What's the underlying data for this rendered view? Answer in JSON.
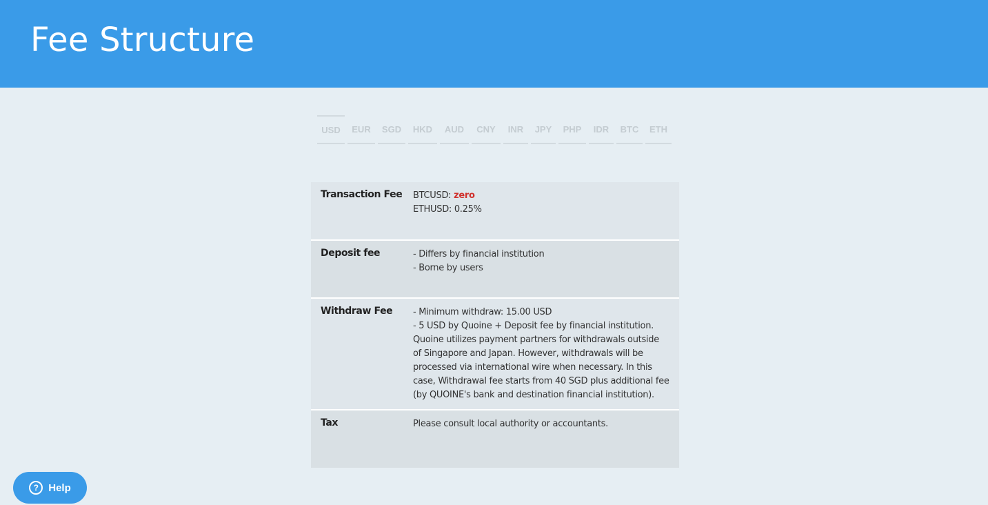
{
  "header": {
    "title": "Fee Structure"
  },
  "currency_tabs": {
    "active": "USD",
    "items": [
      "USD",
      "EUR",
      "SGD",
      "HKD",
      "AUD",
      "CNY",
      "INR",
      "JPY",
      "PHP",
      "IDR",
      "BTC",
      "ETH"
    ]
  },
  "fees": {
    "transaction": {
      "label": "Transaction Fee",
      "btc_prefix": "BTCUSD: ",
      "btc_value": "zero",
      "eth": "ETHUSD: 0.25%"
    },
    "deposit": {
      "label": "Deposit fee",
      "lines": [
        "- Differs by financial institution",
        "- Borne by users"
      ]
    },
    "withdraw": {
      "label": "Withdraw Fee",
      "line1": "- Minimum withdraw: 15.00 USD",
      "line2": "- 5 USD by Quoine + Deposit fee by financial institution. Quoine utilizes payment partners for withdrawals outside of Singapore and Japan. However, withdrawals will be processed via international wire when necessary. In this case, Withdrawal fee starts from 40 SGD plus additional fee (by QUOINE's bank and destination financial institution)."
    },
    "tax": {
      "label": "Tax",
      "text": "Please consult local authority or accountants."
    }
  },
  "help": {
    "label": "Help",
    "icon": "question-circle-icon"
  },
  "colors": {
    "header": "#3a9be8",
    "background": "#e6eef3",
    "zero": "#d0312d"
  }
}
